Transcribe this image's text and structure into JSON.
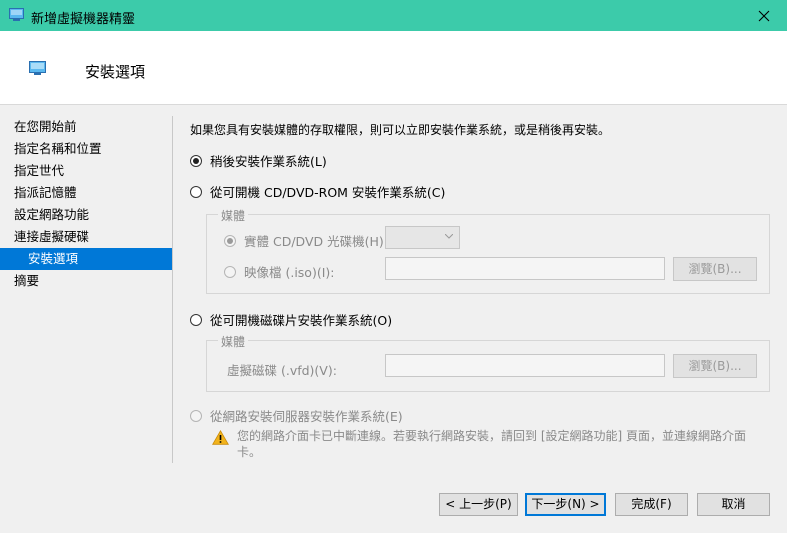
{
  "window": {
    "title": "新增虛擬機器精靈"
  },
  "header": {
    "title": "安裝選項"
  },
  "nav": {
    "items": [
      {
        "label": "在您開始前",
        "active": false,
        "sub": false
      },
      {
        "label": "指定名稱和位置",
        "active": false,
        "sub": false
      },
      {
        "label": "指定世代",
        "active": false,
        "sub": false
      },
      {
        "label": "指派記憶體",
        "active": false,
        "sub": false
      },
      {
        "label": "設定網路功能",
        "active": false,
        "sub": false
      },
      {
        "label": "連接虛擬硬碟",
        "active": false,
        "sub": false
      },
      {
        "label": "安裝選項",
        "active": true,
        "sub": true
      },
      {
        "label": "摘要",
        "active": false,
        "sub": false
      }
    ]
  },
  "content": {
    "intro": "如果您具有安裝媒體的存取權限，則可以立即安裝作業系統，或是稍後再安裝。",
    "option_later": "稍後安裝作業系統(L)",
    "option_cd": "從可開機 CD/DVD-ROM 安裝作業系統(C)",
    "cd_group": {
      "label": "媒體",
      "physical_label": "實體 CD/DVD 光碟機(H):",
      "physical_value": "",
      "image_label": "映像檔 (.iso)(I):",
      "image_value": "",
      "browse_label": "瀏覽(B)..."
    },
    "option_floppy": "從可開機磁碟片安裝作業系統(O)",
    "floppy_group": {
      "label": "媒體",
      "vfd_label": "虛擬磁碟 (.vfd)(V):",
      "vfd_value": "",
      "browse_label": "瀏覽(B)..."
    },
    "option_network": "從網路安裝伺服器安裝作業系統(E)",
    "warning": "您的網路介面卡已中斷連線。若要執行網路安裝，請回到 [設定網路功能] 頁面，並連線網路介面卡。",
    "selected_option": "later"
  },
  "buttons": {
    "previous": "< 上一步(P)",
    "next": "下一步(N) >",
    "finish": "完成(F)",
    "cancel": "取消"
  },
  "colors": {
    "titlebar": "#3ccbaa",
    "accent": "#0078d7",
    "warning": "#e8a317"
  }
}
